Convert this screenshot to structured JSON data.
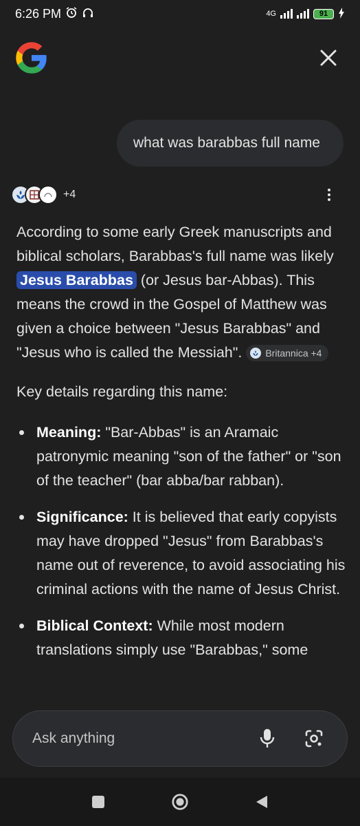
{
  "status_bar": {
    "time": "6:26 PM",
    "network": "4G",
    "battery": "91"
  },
  "header": {
    "logo": "google-g-logo",
    "close_icon": "close-icon"
  },
  "query": {
    "text": "what was barabbas full name"
  },
  "sources": {
    "count": "+4",
    "icons": [
      "britannica-icon",
      "source-icon-2",
      "source-icon-3"
    ]
  },
  "answer": {
    "p1_a": "According to some early Greek manuscripts and biblical scholars, Barabbas's full name was likely ",
    "p1_highlight": "Jesus Barabbas",
    "p1_b": " (or Jesus bar-Abbas). This means the crowd in the Gospel of Matthew was given a choice between \"Jesus Barabbas\" and \"Jesus who is called the Messiah\". ",
    "citation_chip": "Britannica +4",
    "intro": "Key details regarding this name:",
    "bullets": [
      {
        "label": "Meaning:",
        "text": " \"Bar-Abbas\" is an Aramaic patronymic meaning \"son of the father\" or \"son of the teacher\" (bar abba/bar rabban)."
      },
      {
        "label": "Significance:",
        "text": " It is believed that early copyists may have dropped \"Jesus\" from Barabbas's name out of reverence, to avoid associating his criminal actions with the name of Jesus Christ."
      },
      {
        "label": "Biblical Context:",
        "text": " While most modern translations simply use \"Barabbas,\" some"
      }
    ]
  },
  "input": {
    "placeholder": "Ask anything"
  },
  "colors": {
    "background": "#1f1f1f",
    "bubble": "#2b2c2f",
    "highlight": "#2a4dab",
    "text": "#e3e3e3"
  }
}
